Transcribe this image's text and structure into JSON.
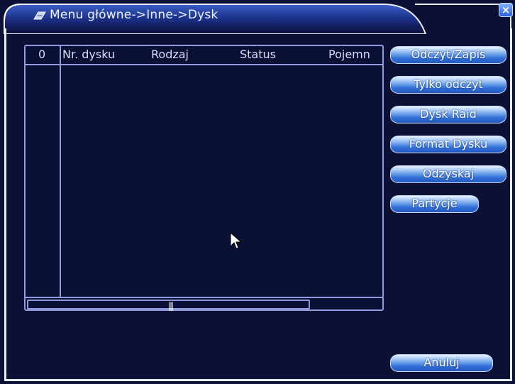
{
  "window": {
    "title": "Menu główne->Inne->Dysk",
    "close_label": "×"
  },
  "table": {
    "headers": [
      "0",
      "Nr. dysku",
      "Rodzaj",
      "Status",
      "Pojemn"
    ],
    "rows": [],
    "scroll_thumb": "|||"
  },
  "actions": {
    "read_write": "Odczyt/Zapis",
    "read_only": "Tylko odczyt",
    "raid": "Dysk Raid",
    "format": "Format Dysku",
    "recover": "Odzyskaj",
    "partitions": "Partycje",
    "cancel": "Anuluj"
  },
  "colors": {
    "background": "#0b1034",
    "border": "#8f9ad8",
    "button": "#2f6fd6"
  }
}
